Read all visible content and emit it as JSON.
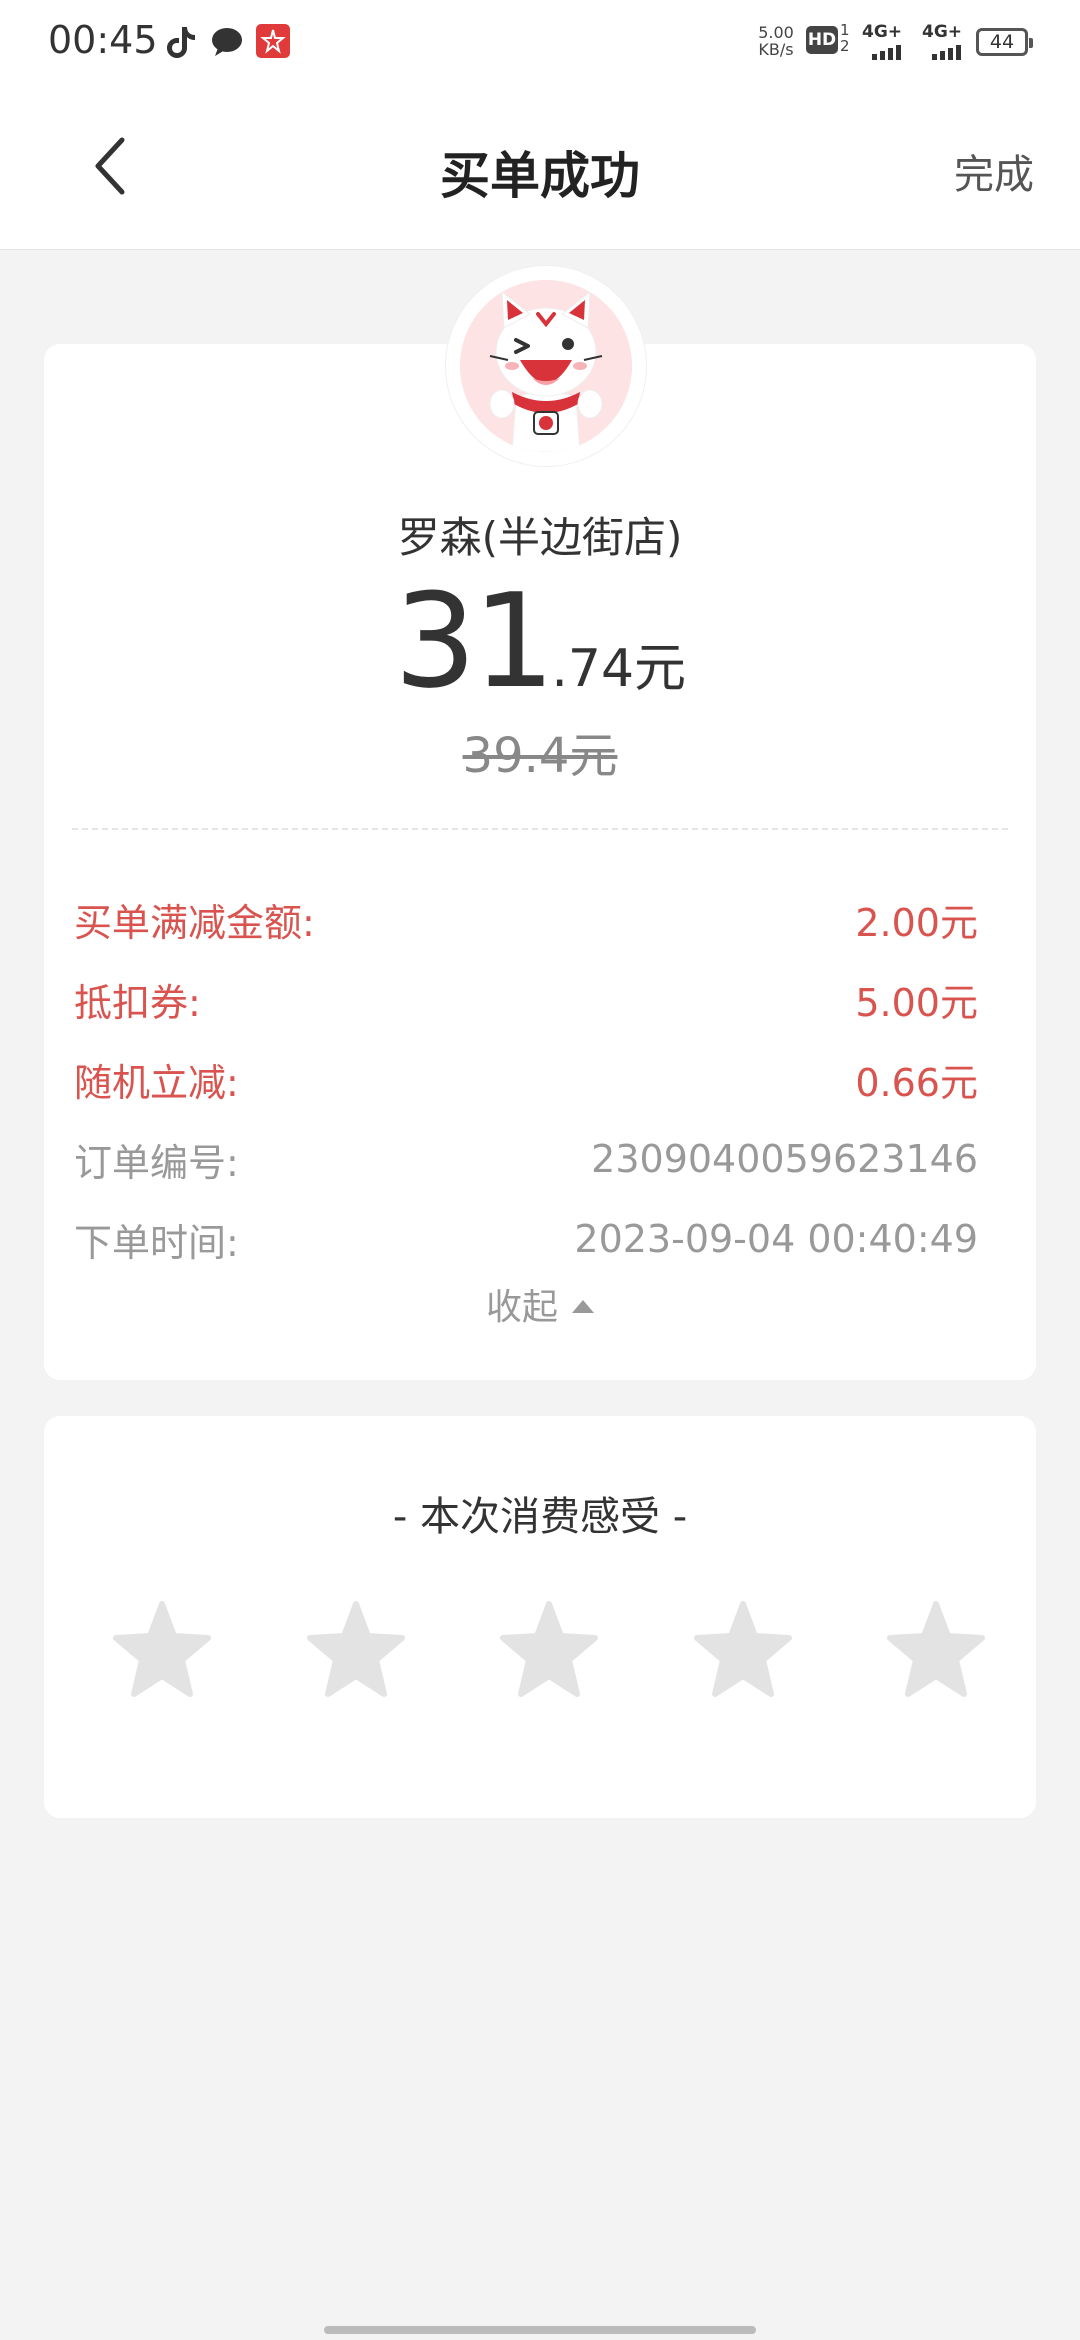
{
  "status_bar": {
    "time": "00:45",
    "net_speed_value": "5.00",
    "net_speed_unit": "KB/s",
    "hd_label": "HD",
    "sim_slot_1": "1",
    "sim_slot_2": "2",
    "signal_1": "4G+",
    "signal_2": "4G+",
    "battery": "44",
    "app_icons": [
      "tiktok-icon",
      "chat-bubble-icon",
      "red-app-icon"
    ]
  },
  "nav": {
    "title": "买单成功",
    "done_label": "完成",
    "back_icon": "chevron-left-icon"
  },
  "receipt": {
    "store_name": "罗森(半边街店)",
    "amount_integer": "31",
    "amount_decimal": ".74元",
    "original_amount": "39.4元",
    "rows": [
      {
        "label": "买单满减金额:",
        "value": "2.00元",
        "style": "discount"
      },
      {
        "label": "抵扣券:",
        "value": "5.00元",
        "style": "discount"
      },
      {
        "label": "随机立减:",
        "value": "0.66元",
        "style": "discount"
      },
      {
        "label": "订单编号:",
        "value": "2309040059623146",
        "style": "info"
      },
      {
        "label": "下单时间:",
        "value": "2023-09-04 00:40:49",
        "style": "info"
      }
    ],
    "collapse_label": "收起"
  },
  "rating": {
    "title": "- 本次消费感受 -",
    "max_stars": 5,
    "selected_stars": 0
  },
  "colors": {
    "discount_red": "#d9534f",
    "star_gray": "#e3e3e3",
    "background": "#f3f3f3"
  }
}
